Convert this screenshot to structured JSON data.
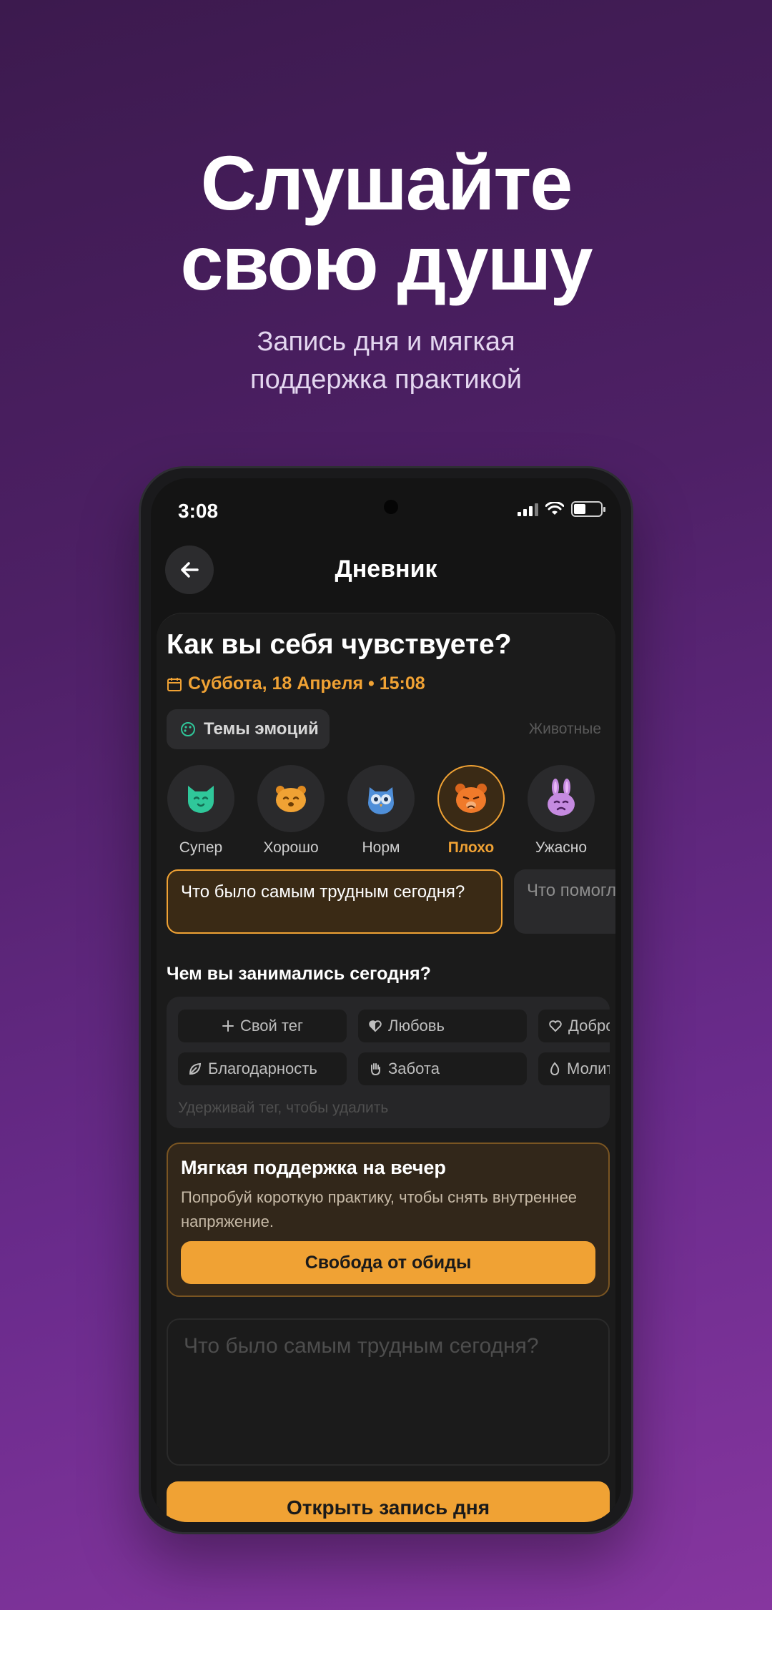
{
  "promo": {
    "headline_line1": "Слушайте",
    "headline_line2": "свою душу",
    "subtitle_line1": "Запись дня и мягкая",
    "subtitle_line2": "поддержка практикой"
  },
  "status_bar": {
    "time": "3:08"
  },
  "nav": {
    "title": "Дневник",
    "back_icon": "arrow-left-icon"
  },
  "header": {
    "question": "Как вы себя чувствуете?",
    "date": "Суббота, 18 Апреля • 15:08"
  },
  "themes": {
    "button_label": "Темы эмоций",
    "current_theme": "Животные"
  },
  "moods": [
    {
      "label": "Супер",
      "icon": "cat-icon",
      "color": "#2fc79a",
      "selected": false
    },
    {
      "label": "Хорошо",
      "icon": "hamster-icon",
      "color": "#f0a234",
      "selected": false
    },
    {
      "label": "Норм",
      "icon": "owl-icon",
      "color": "#4f8fd9",
      "selected": false
    },
    {
      "label": "Плохо",
      "icon": "bear-icon",
      "color": "#f07a2a",
      "selected": true
    },
    {
      "label": "Ужасно",
      "icon": "bunny-icon",
      "color": "#c58ae0",
      "selected": false
    }
  ],
  "prompts": [
    {
      "text": "Что было самым трудным сегодня?",
      "selected": true
    },
    {
      "text": "Что помогло",
      "selected": false
    }
  ],
  "activities": {
    "title": "Чем вы занимались сегодня?",
    "tags": [
      {
        "label": "Свой тег",
        "icon": "plus-icon"
      },
      {
        "label": "Любовь",
        "icon": "heart-half-icon"
      },
      {
        "label": "Доброта",
        "icon": "heart-icon"
      },
      {
        "label": "Благодарность",
        "icon": "leaf-icon"
      },
      {
        "label": "Забота",
        "icon": "hand-icon"
      },
      {
        "label": "Молитва",
        "icon": "flame-icon"
      }
    ],
    "hint": "Удерживай тег, чтобы удалить"
  },
  "support": {
    "title": "Мягкая поддержка на вечер",
    "text": "Попробуй короткую практику, чтобы снять внутреннее напряжение.",
    "button": "Свобода от обиды"
  },
  "entry": {
    "placeholder": "Что было самым трудным сегодня?"
  },
  "cta": {
    "label": "Открыть запись дня"
  },
  "colors": {
    "accent": "#f0a234",
    "background": "#141414",
    "card": "#262628",
    "promo_purple": "#5a2478"
  }
}
